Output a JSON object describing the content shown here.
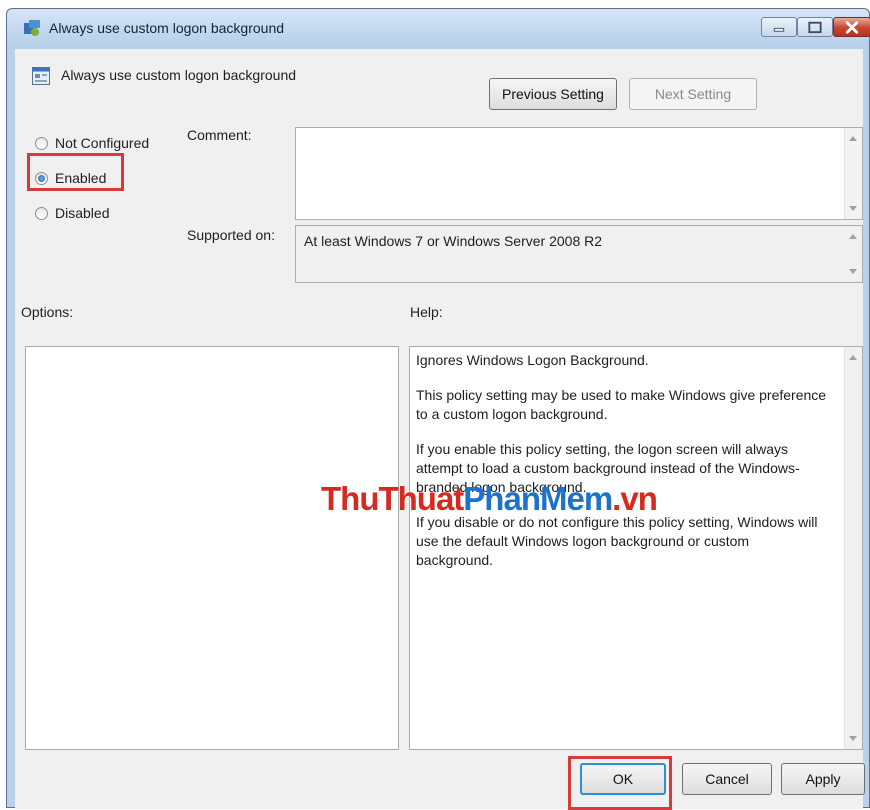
{
  "window": {
    "title": "Always use custom logon background"
  },
  "header": {
    "setting_name": "Always use custom logon background",
    "previous_label": "Previous Setting",
    "next_label": "Next Setting"
  },
  "state": {
    "options": [
      {
        "label": "Not Configured",
        "checked": false
      },
      {
        "label": "Enabled",
        "checked": true
      },
      {
        "label": "Disabled",
        "checked": false
      }
    ]
  },
  "fields": {
    "comment_label": "Comment:",
    "comment_value": "",
    "supported_label": "Supported on:",
    "supported_value": "At least Windows 7 or Windows Server 2008 R2"
  },
  "panes": {
    "options_label": "Options:",
    "help_label": "Help:",
    "help_paragraphs": [
      "Ignores Windows Logon Background.",
      "This policy setting may be used to make Windows give preference to a custom logon background.",
      "If you enable this policy setting, the logon screen will always attempt to load a custom background instead of the Windows-branded logon background.",
      "If you disable or do not configure this policy setting, Windows will use the default Windows logon background or custom background."
    ]
  },
  "watermark": {
    "part1": "ThuThuat",
    "part2": "PhanMem",
    "part3": ".vn"
  },
  "footer": {
    "ok_label": "OK",
    "cancel_label": "Cancel",
    "apply_label": "Apply"
  },
  "colors": {
    "highlight": "#d63a3a",
    "watermark_red": "#d42a1f",
    "watermark_blue": "#1e73c8"
  }
}
